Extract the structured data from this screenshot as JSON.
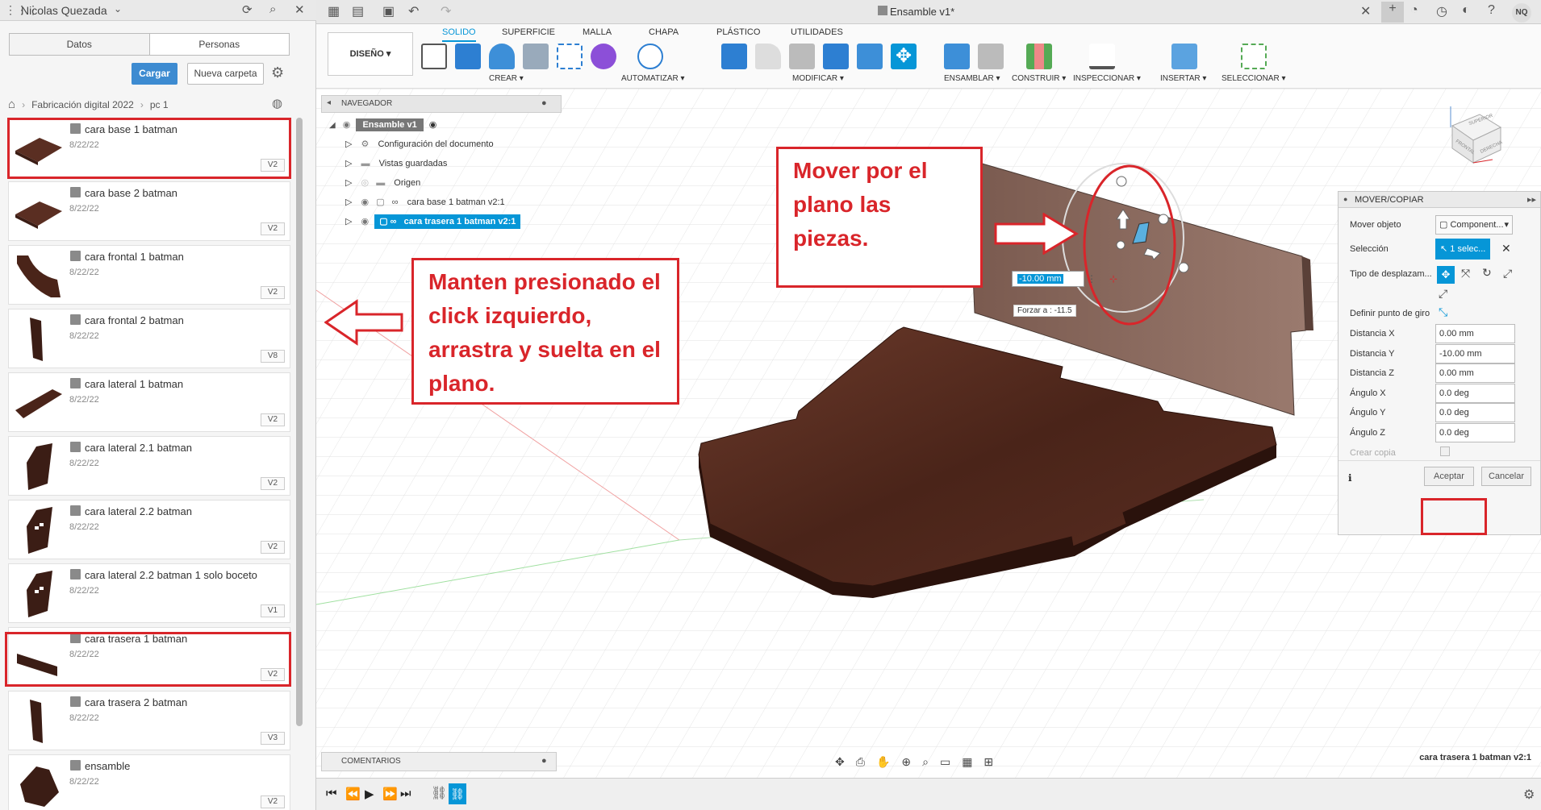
{
  "left_panel": {
    "user": "Nicolas Quezada",
    "tabs": [
      "Datos",
      "Personas"
    ],
    "upload_label": "Cargar",
    "new_folder_label": "Nueva carpeta",
    "breadcrumb": [
      "Fabricación digital 2022",
      "pc 1"
    ],
    "files": [
      {
        "name": "cara base 1 batman",
        "date": "8/22/22",
        "version": "V2"
      },
      {
        "name": "cara base 2 batman",
        "date": "8/22/22",
        "version": "V2"
      },
      {
        "name": "cara frontal 1 batman",
        "date": "8/22/22",
        "version": "V2"
      },
      {
        "name": "cara frontal 2 batman",
        "date": "8/22/22",
        "version": "V8"
      },
      {
        "name": "cara lateral 1 batman",
        "date": "8/22/22",
        "version": "V2"
      },
      {
        "name": "cara lateral 2.1 batman",
        "date": "8/22/22",
        "version": "V2"
      },
      {
        "name": "cara lateral 2.2 batman",
        "date": "8/22/22",
        "version": "V2"
      },
      {
        "name": "cara lateral 2.2 batman 1 solo boceto",
        "date": "8/22/22",
        "version": "V1"
      },
      {
        "name": "cara trasera 1 batman",
        "date": "8/22/22",
        "version": "V2"
      },
      {
        "name": "cara trasera 2 batman",
        "date": "8/22/22",
        "version": "V3"
      },
      {
        "name": "ensamble",
        "date": "8/22/22",
        "version": "V2"
      }
    ]
  },
  "topbar": {
    "doc_title": "Ensamble v1*",
    "avatar": "NQ"
  },
  "ribbon": {
    "workspace": "DISEÑO",
    "tabs": [
      "SOLIDO",
      "SUPERFICIE",
      "MALLA",
      "CHAPA",
      "PLÁSTICO",
      "UTILIDADES"
    ],
    "groups": [
      "CREAR",
      "AUTOMATIZAR",
      "MODIFICAR",
      "ENSAMBLAR",
      "CONSTRUIR",
      "INSPECCIONAR",
      "INSERTAR",
      "SELECCIONAR"
    ]
  },
  "navigator": {
    "title": "NAVEGADOR",
    "root": "Ensamble v1",
    "items": [
      "Configuración del documento",
      "Vistas guardadas",
      "Origen",
      "cara base 1 batman v2:1",
      "cara trasera 1 batman v2:1"
    ]
  },
  "callouts": {
    "left": "Manten presionado el click izquierdo, arrastra y suelta en el plano.",
    "top": "Mover por el plano las piezas."
  },
  "viewport": {
    "input_value": "-10.00 mm",
    "force_label": "Forzar a : -11.5",
    "status_selection": "cara trasera 1 batman v2:1",
    "viewcube": [
      "SUPERIOR",
      "FRONTAL",
      "DERECHA"
    ]
  },
  "move_panel": {
    "title": "MOVER/COPIAR",
    "mover_objeto_label": "Mover objeto",
    "mover_objeto_value": "Component...",
    "seleccion_label": "Selección",
    "seleccion_value": "1 selec...",
    "tipo_label": "Tipo de desplazam...",
    "pivot_label": "Definir punto de giro",
    "fields": [
      {
        "label": "Distancia X",
        "value": "0.00 mm"
      },
      {
        "label": "Distancia Y",
        "value": "-10.00 mm"
      },
      {
        "label": "Distancia Z",
        "value": "0.00 mm"
      },
      {
        "label": "Ángulo X",
        "value": "0.0 deg"
      },
      {
        "label": "Ángulo Y",
        "value": "0.0 deg"
      },
      {
        "label": "Ángulo Z",
        "value": "0.0 deg"
      }
    ],
    "copy_label": "Crear copia",
    "accept_label": "Aceptar",
    "cancel_label": "Cancelar"
  },
  "comments_label": "COMENTARIOS",
  "colors": {
    "accent": "#0696d7",
    "callout": "#d9252a",
    "wood": "#5a2e22"
  }
}
